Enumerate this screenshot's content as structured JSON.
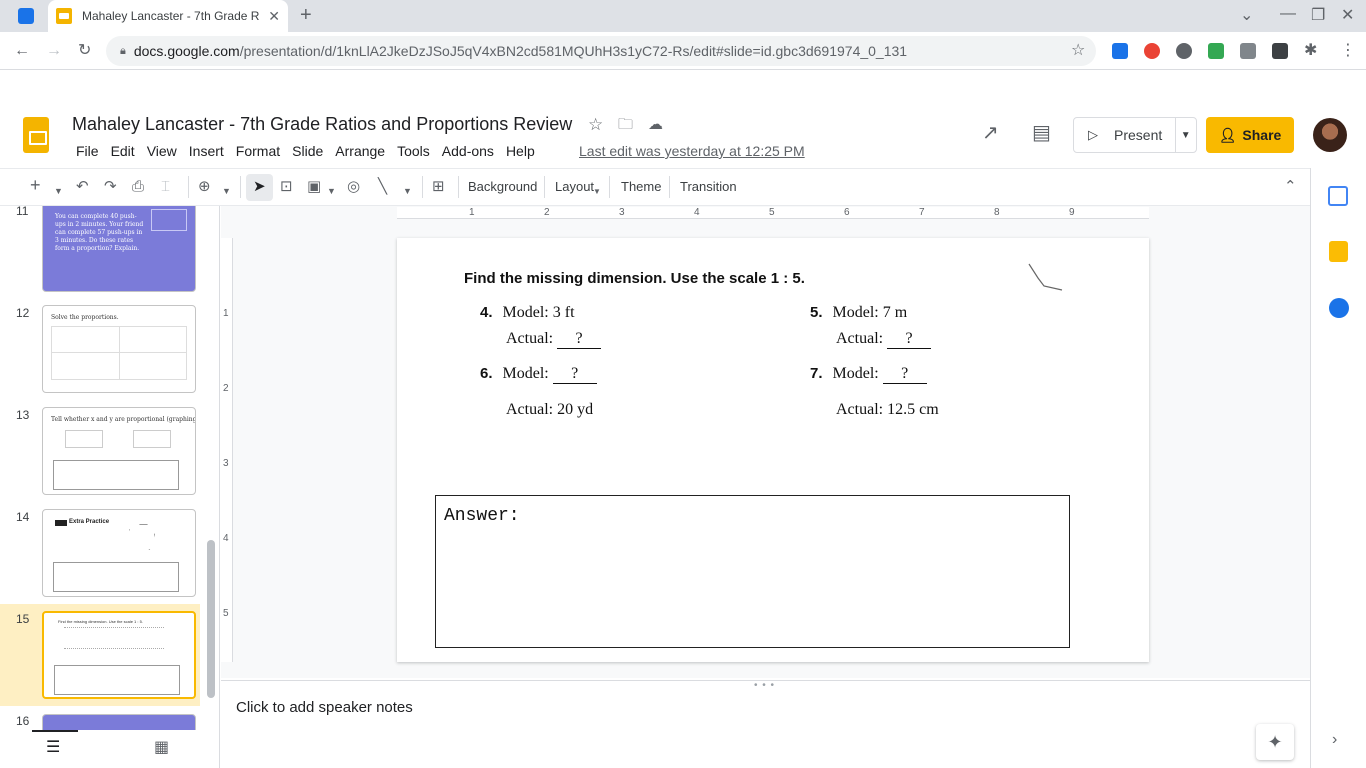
{
  "browser": {
    "tab_title": "Mahaley Lancaster - 7th Grade R",
    "url_host": "docs.google.com",
    "url_path": "/presentation/d/1knLlA2JkeDzJSoJ5qV4xBN2cd581MQUhH3s1yC72-Rs/edit#slide=id.gbc3d691974_0_131"
  },
  "doc": {
    "title": "Mahaley Lancaster - 7th Grade Ratios and Proportions Review",
    "last_edit": "Last edit was yesterday at 12:25 PM",
    "present_label": "Present",
    "share_label": "Share"
  },
  "menu": [
    "File",
    "Edit",
    "View",
    "Insert",
    "Format",
    "Slide",
    "Arrange",
    "Tools",
    "Add-ons",
    "Help"
  ],
  "toolbar": {
    "background": "Background",
    "layout": "Layout",
    "theme": "Theme",
    "transition": "Transition"
  },
  "filmstrip": {
    "slides": [
      {
        "num": "11",
        "text": "You can complete 40 push-ups in 2 minutes. Your friend can complete 57 push-ups in 3 minutes. Do these rates form a proportion? Explain."
      },
      {
        "num": "12",
        "text": "Solve the proportions."
      },
      {
        "num": "13",
        "text": "Tell whether x and y are proportional (graphing)."
      },
      {
        "num": "14",
        "text": "Extra Practice"
      },
      {
        "num": "15",
        "text": "Find the missing dimension. Use the scale 1 : 5."
      },
      {
        "num": "16",
        "text": ""
      }
    ]
  },
  "ruler": {
    "h": [
      "1",
      "2",
      "3",
      "4",
      "5",
      "6",
      "7",
      "8",
      "9"
    ],
    "v": [
      "1",
      "2",
      "3",
      "4",
      "5"
    ]
  },
  "slide": {
    "heading": "Find the missing dimension. Use the scale 1 : 5.",
    "problems": [
      {
        "num": "4.",
        "line1_label": "Model:",
        "line1_value": "3 ft",
        "line2_label": "Actual:",
        "line2_value": "?"
      },
      {
        "num": "5.",
        "line1_label": "Model:",
        "line1_value": "7 m",
        "line2_label": "Actual:",
        "line2_value": "?"
      },
      {
        "num": "6.",
        "line1_label": "Model:",
        "line1_value": "?",
        "line2_label": "Actual:",
        "line2_value": "20 yd"
      },
      {
        "num": "7.",
        "line1_label": "Model:",
        "line1_value": "?",
        "line2_label": "Actual:",
        "line2_value": "12.5 cm"
      }
    ],
    "answer_label": "Answer:"
  },
  "notes": {
    "placeholder": "Click to add speaker notes"
  },
  "colors": {
    "accent_yellow": "#f9b900",
    "selected_slide_bg": "#feefc3",
    "selected_border": "#f9b900",
    "thumb_purple": "#7b7bd9"
  }
}
